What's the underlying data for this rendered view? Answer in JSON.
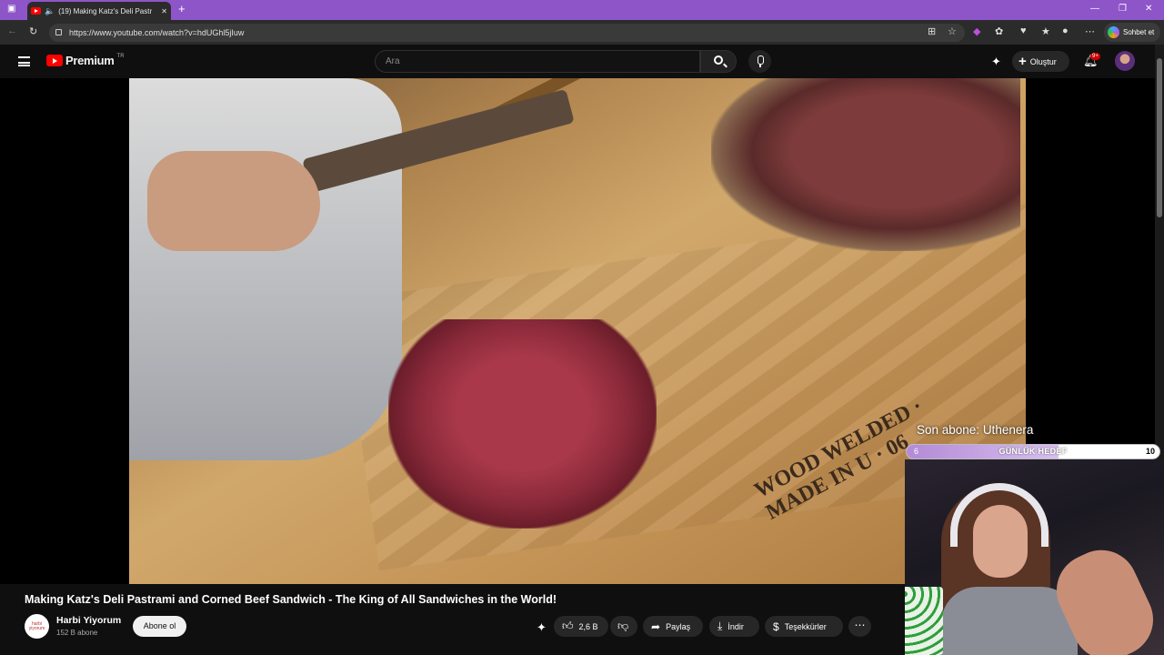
{
  "browser": {
    "tab_title": "(19) Making Katz's Deli Pastr",
    "url": "https://www.youtube.com/watch?v=hdUGhl5jIuw",
    "chat_label": "Sohbet et"
  },
  "youtube": {
    "logo_text": "Premium",
    "logo_region": "TR",
    "search_placeholder": "Ara",
    "create_label": "Oluştur",
    "notifications_badge": "9+"
  },
  "video": {
    "title": "Making Katz's Deli Pastrami and Corned Beef Sandwich - The King of All Sandwiches in the World!",
    "frame_stamp_text": "WOOD WELDED · MADE IN U · 06"
  },
  "channel": {
    "name": "Harbi Yiyorum",
    "subscribers": "152 B abone",
    "avatar_text": "harbi yiyorum",
    "subscribe_label": "Abone ol"
  },
  "actions": {
    "like_count": "2,6 B",
    "share_label": "Paylaş",
    "download_label": "İndir",
    "thanks_label": "Teşekkürler"
  },
  "overlay": {
    "last_subscriber": "Son abone: Uthenera",
    "goal_label": "GÜNLÜK HEDEF",
    "goal_current": "6",
    "goal_target": "10",
    "goal_progress": 0.6
  }
}
